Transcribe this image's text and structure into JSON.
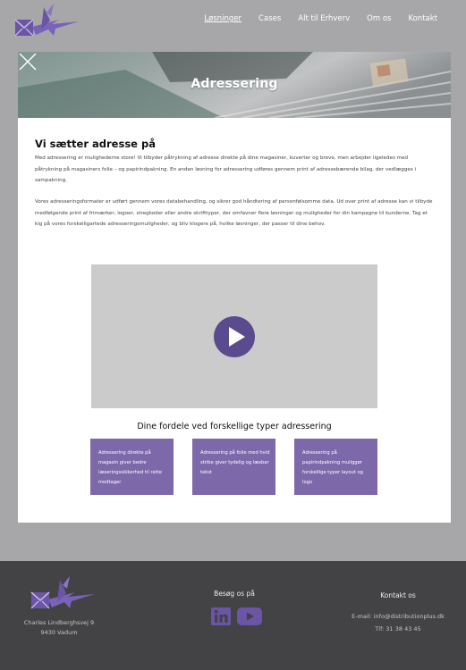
{
  "nav": {
    "items": [
      {
        "label": "Løsninger",
        "active": true
      },
      {
        "label": "Cases"
      },
      {
        "label": "Alt til Erhverv"
      },
      {
        "label": "Om os"
      },
      {
        "label": "Kontakt"
      }
    ]
  },
  "modal": {
    "banner_title": "Adressering",
    "heading": "Vi sætter adresse på",
    "paragraph_1": "Med adressering er mulighederne store! Vi tilbyder påtrykning af adresse direkte på dine magasiner, kuverter og breve, men arbejder ligeledes med påtrykning på magasiners folie – og papirindpakning. En anden løsning for adressering udføres gennem print af adressebærende bilag, der vedlægges i sampakning.",
    "paragraph_2": "Vores adresseringsformater er udført gennem vores databehandling, og sikrer god håndtering af personfølsomme data. Ud over print af adresse kan vi tilbyde medfølgende print af frimærker, logoer, stregkoder eller andre skrifttyper, der omfavner flere løsninger og muligheder for din kampagne til kunderne. Tag et kig på vores forskelligartede adresseringsmuligheder, og bliv klogere på, hvilke løsninger, der passer til dine behov.",
    "benefits_title": "Dine fordele ved forskellige typer adressering",
    "cards": [
      {
        "text": "Adressering direkte på magasin giver bedre læseringssikkerhed til rette modtager"
      },
      {
        "text": "Adressering på folie med hvid stribe giver tydelig og læsbar tekst"
      },
      {
        "text": "Adressering på papirindpakning muliggør forskellige typer layout og logo"
      }
    ]
  },
  "footer": {
    "address_line_1": "Charles Lindberghsvej 9",
    "address_line_2": "9430 Vadum",
    "visit_title": "Besøg os på",
    "contact_title": "Kontakt os",
    "email_label": "E-mail:",
    "email": "info@distributionplus.dk",
    "phone_label": "Tlf:",
    "phone": "31 38 43 45"
  },
  "colors": {
    "page_background": "#a7a7a9",
    "brand_purple": "#7d68aa",
    "play_purple": "#5a4a8e",
    "footer_background": "#434244"
  },
  "icons": {
    "logo": "distributionplus-logo",
    "close": "close-icon",
    "play": "play-icon",
    "linkedin": "linkedin-icon",
    "youtube": "youtube-icon"
  }
}
